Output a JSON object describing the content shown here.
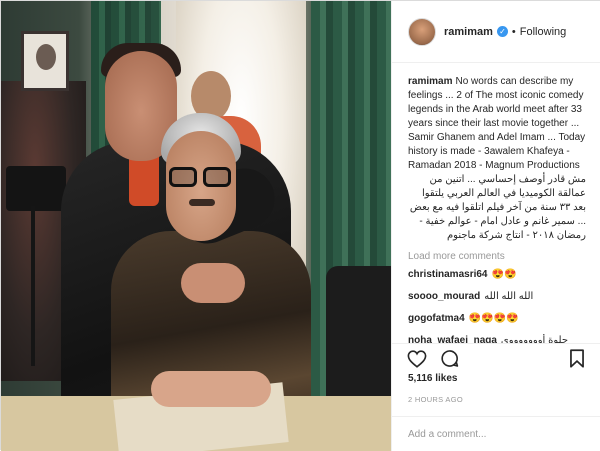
{
  "post": {
    "username": "ramimam",
    "follow_status": "Following",
    "separator": "•",
    "verified_glyph": "✓",
    "caption": "No words can describe my feelings ... 2 of The most iconic comedy legends in the Arab world meet after 33 years since their last movie together ... Samir Ghanem and Adel Imam ... Today history is made - 3awalem Khafeya - Ramadan 2018 - Magnum Productions",
    "caption_ar": "مش قادر أوصف إحساسي ... اتنين من عمالقة الكوميديا في العالم العربي يلتقوا بعد ٣٣ سنة من آخر فيلم اتلقوا فيه مع بعض ... سمير غانم و عادل امام - عوالم خفية - رمضان ٢٠١٨ - انتاج شركة ماجنوم",
    "load_more": "Load more comments",
    "comments": [
      {
        "user": "christinamasri64",
        "text": "😍😍"
      },
      {
        "user": "soooo_mourad",
        "text": "الله الله الله"
      },
      {
        "user": "gogofatma4",
        "text": "😍😍😍😍"
      },
      {
        "user": "noha_wafaei_naga",
        "text": "حلوة أوووووووي"
      }
    ],
    "likes": "5,116 likes",
    "time": "2 HOURS AGO",
    "add_comment_placeholder": "Add a comment..."
  },
  "icons": {
    "like": "heart-icon",
    "comment": "comment-icon",
    "save": "bookmark-icon",
    "verified": "verified-badge-icon"
  },
  "colors": {
    "verified": "#3897f0",
    "muted": "#999999",
    "text": "#262626",
    "border": "#efefef"
  }
}
